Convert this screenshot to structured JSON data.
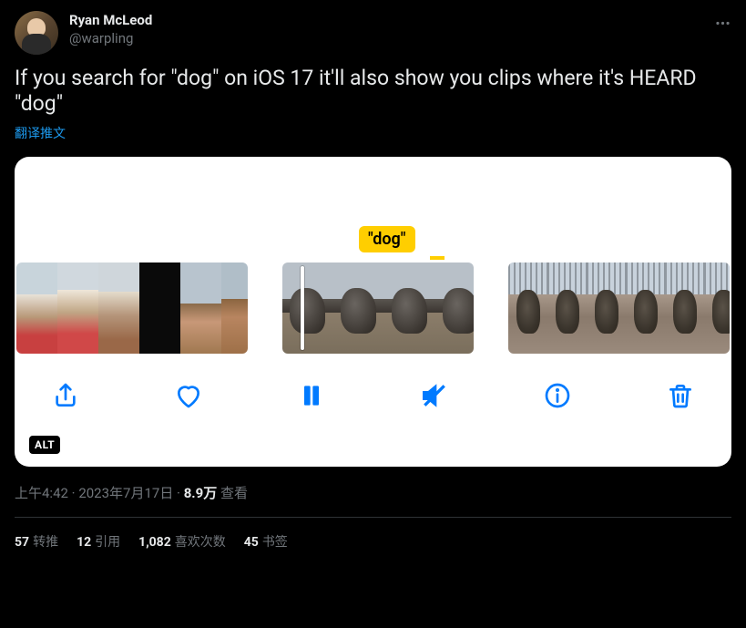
{
  "author": {
    "display_name": "Ryan McLeod",
    "handle": "@warpling"
  },
  "tweet_text": "If you search for \"dog\" on iOS 17 it'll also show you clips where it's HEARD \"dog\"",
  "translate_label": "翻译推文",
  "media": {
    "caption_pill": "\"dog\"",
    "alt_badge": "ALT",
    "toolbar": {
      "share": "share",
      "like": "like",
      "pause": "pause",
      "mute": "mute",
      "info": "info",
      "delete": "delete"
    }
  },
  "meta": {
    "time": "上午4:42",
    "separator1": " · ",
    "date": "2023年7月17日",
    "separator2": " · ",
    "views_count": "8.9万",
    "views_label": " 查看"
  },
  "stats": {
    "retweets_n": "57",
    "retweets_l": "转推",
    "quotes_n": "12",
    "quotes_l": "引用",
    "likes_n": "1,082",
    "likes_l": "喜欢次数",
    "bookmarks_n": "45",
    "bookmarks_l": "书签"
  }
}
